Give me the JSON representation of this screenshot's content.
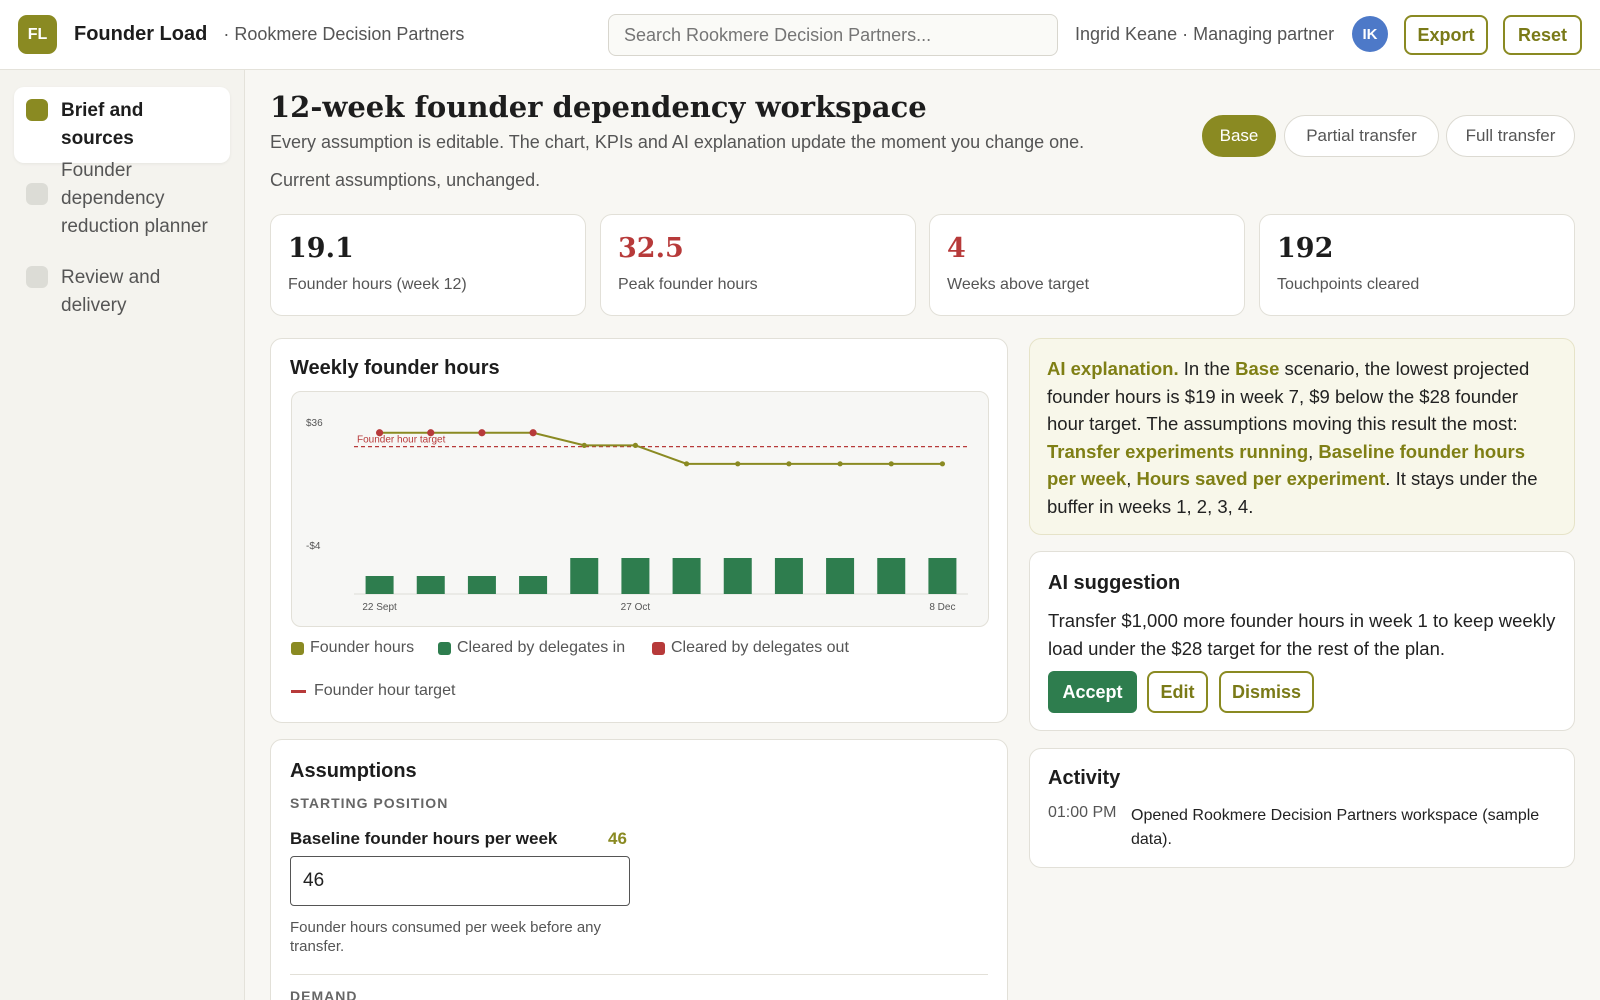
{
  "app": {
    "logo_initials": "FL",
    "name": "Founder Load",
    "org": "· Rookmere Decision Partners",
    "search_placeholder": "Search Rookmere Decision Partners...",
    "user": "Ingrid Keane · Managing partner",
    "user_initials": "IK",
    "export_label": "Export",
    "reset_label": "Reset"
  },
  "sidebar": {
    "items": [
      {
        "label": "Brief and sources",
        "active": true
      },
      {
        "label": "Founder dependency reduction planner",
        "active": false
      },
      {
        "label": "Review and delivery",
        "active": false
      }
    ]
  },
  "header": {
    "title": "12-week founder dependency workspace",
    "subtitle": "Every assumption is editable. The chart, KPIs and AI explanation update the moment you change one.",
    "status": "Current assumptions, unchanged.",
    "scenarios": [
      "Base",
      "Partial transfer",
      "Full transfer"
    ],
    "active_scenario": "Base"
  },
  "kpis": [
    {
      "value": "19.1",
      "label": "Founder hours (week 12)",
      "alert": false
    },
    {
      "value": "32.5",
      "label": "Peak founder hours",
      "alert": true
    },
    {
      "value": "4",
      "label": "Weeks above target",
      "alert": true
    },
    {
      "value": "192",
      "label": "Touchpoints cleared",
      "alert": false
    }
  ],
  "chart_card": {
    "title": "Weekly founder hours"
  },
  "chart_data": {
    "type": "line",
    "title": "Weekly founder hours",
    "x_tick_labels": [
      "22 Sept",
      "27 Oct",
      "8 Dec"
    ],
    "x_tick_positions": [
      1,
      6,
      12
    ],
    "y_tick_labels": [
      "$36",
      "-$4"
    ],
    "ylim": [
      -4,
      36
    ],
    "categories": [
      1,
      2,
      3,
      4,
      5,
      6,
      7,
      8,
      9,
      10,
      11,
      12
    ],
    "series": [
      {
        "name": "Founder hours",
        "type": "line",
        "color": "#8a8a22",
        "values": [
          32.5,
          32.5,
          32.5,
          32.5,
          28.4,
          28.4,
          22.4,
          22.4,
          22.4,
          22.4,
          22.4,
          22.4
        ]
      },
      {
        "name": "Cleared by delegates in",
        "type": "bar",
        "color": "#2e7d4e",
        "values": [
          4,
          4,
          4,
          4,
          8,
          8,
          8,
          8,
          8,
          8,
          8,
          8
        ]
      },
      {
        "name": "Cleared by delegates out",
        "type": "marker",
        "color": "#b73a3a",
        "values": [
          32.5,
          32.5,
          32.5,
          32.5,
          null,
          null,
          null,
          null,
          null,
          null,
          null,
          null
        ]
      }
    ],
    "target": {
      "name": "Founder hour target",
      "label": "Founder hour target",
      "value": 28,
      "color": "#b73a3a"
    },
    "legend": [
      "Founder hours",
      "Cleared by delegates in",
      "Cleared by delegates out",
      "Founder hour target"
    ],
    "legend_position": "bottom",
    "grid": false
  },
  "assumptions": {
    "title": "Assumptions",
    "section_start": "STARTING POSITION",
    "field_label": "Baseline founder hours per week",
    "field_value": "46",
    "field_input_value": "46",
    "field_help": "Founder hours consumed per week before any transfer.",
    "section_demand": "DEMAND"
  },
  "ai_explanation": {
    "lead": "AI explanation.",
    "t1": " In the ",
    "scenario": "Base",
    "t2": " scenario, the lowest projected founder hours is $19 in week 7, $9 below the $28 founder hour target. The assumptions moving this result the most: ",
    "d1": "Transfer experiments running",
    "sep1": ", ",
    "d2": "Baseline founder hours per week",
    "sep2": ", ",
    "d3": "Hours saved per experiment",
    "t3": ". It stays under the buffer in weeks 1, 2, 3, 4."
  },
  "ai_suggestion": {
    "title": "AI suggestion",
    "text": "Transfer $1,000 more founder hours in week 1 to keep weekly load under the $28 target for the rest of the plan.",
    "accept": "Accept",
    "edit": "Edit",
    "dismiss": "Dismiss"
  },
  "activity": {
    "title": "Activity",
    "items": [
      {
        "time": "01:00 PM",
        "text": "Opened Rookmere Decision Partners workspace (sample data)."
      }
    ]
  },
  "colors": {
    "accent": "#8a8a22",
    "success": "#2e7d4e",
    "danger": "#b73a3a"
  }
}
